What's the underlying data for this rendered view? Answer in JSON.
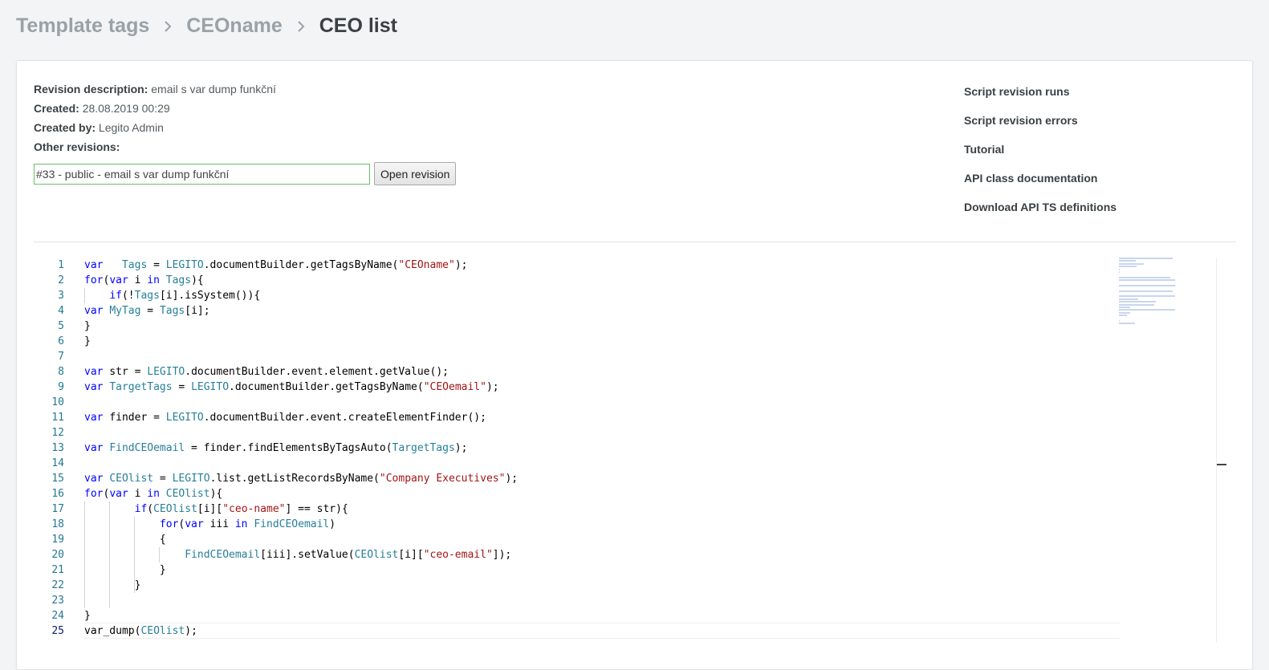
{
  "breadcrumb": {
    "items": [
      "Template tags",
      "CEOname"
    ],
    "current": "CEO list"
  },
  "meta": {
    "description_label": "Revision description:",
    "description_value": "email s var dump funkční",
    "created_label": "Created:",
    "created_value": "28.08.2019 00:29",
    "created_by_label": "Created by:",
    "created_by_value": "Legito Admin",
    "other_revisions_label": "Other revisions:"
  },
  "revision": {
    "selected": "#33 - public - email s var dump funkční",
    "open_button": "Open revision"
  },
  "links": {
    "runs": "Script revision runs",
    "errors": "Script revision errors",
    "tutorial": "Tutorial",
    "api_docs": "API class documentation",
    "ts_defs": "Download API TS definitions"
  },
  "editor": {
    "current_line": 25,
    "lines": [
      [
        [
          "k",
          "var"
        ],
        [
          "",
          "   "
        ],
        [
          "t",
          "Tags"
        ],
        [
          "",
          " = "
        ],
        [
          "t",
          "LEGITO"
        ],
        [
          "",
          ".documentBuilder.getTagsByName("
        ],
        [
          "s",
          "\"CEOname\""
        ],
        [
          "",
          ");"
        ]
      ],
      [
        [
          "k",
          "for"
        ],
        [
          "",
          "("
        ],
        [
          "k",
          "var"
        ],
        [
          "",
          " i "
        ],
        [
          "k",
          "in"
        ],
        [
          "",
          " "
        ],
        [
          "t",
          "Tags"
        ],
        [
          "",
          "){"
        ]
      ],
      [
        [
          "",
          "    "
        ],
        [
          "k",
          "if"
        ],
        [
          "",
          "(!"
        ],
        [
          "t",
          "Tags"
        ],
        [
          "",
          "[i].isSystem()){"
        ]
      ],
      [
        [
          "k",
          "var"
        ],
        [
          "",
          " "
        ],
        [
          "t",
          "MyTag"
        ],
        [
          "",
          " = "
        ],
        [
          "t",
          "Tags"
        ],
        [
          "",
          "[i];"
        ]
      ],
      [
        [
          "",
          "}"
        ]
      ],
      [
        [
          "",
          "}"
        ]
      ],
      [],
      [
        [
          "k",
          "var"
        ],
        [
          "",
          " str = "
        ],
        [
          "t",
          "LEGITO"
        ],
        [
          "",
          ".documentBuilder.event.element.getValue();"
        ]
      ],
      [
        [
          "k",
          "var"
        ],
        [
          "",
          " "
        ],
        [
          "t",
          "TargetTags"
        ],
        [
          "",
          " = "
        ],
        [
          "t",
          "LEGITO"
        ],
        [
          "",
          ".documentBuilder.getTagsByName("
        ],
        [
          "s",
          "\"CEOemail\""
        ],
        [
          "",
          ");"
        ]
      ],
      [],
      [
        [
          "k",
          "var"
        ],
        [
          "",
          " finder = "
        ],
        [
          "t",
          "LEGITO"
        ],
        [
          "",
          ".documentBuilder.event.createElementFinder();"
        ]
      ],
      [],
      [
        [
          "k",
          "var"
        ],
        [
          "",
          " "
        ],
        [
          "t",
          "FindCEOemail"
        ],
        [
          "",
          " = finder.findElementsByTagsAuto("
        ],
        [
          "t",
          "TargetTags"
        ],
        [
          "",
          ");"
        ]
      ],
      [],
      [
        [
          "k",
          "var"
        ],
        [
          "",
          " "
        ],
        [
          "t",
          "CEOlist"
        ],
        [
          "",
          " = "
        ],
        [
          "t",
          "LEGITO"
        ],
        [
          "",
          ".list.getListRecordsByName("
        ],
        [
          "s",
          "\"Company Executives\""
        ],
        [
          "",
          ");"
        ]
      ],
      [
        [
          "k",
          "for"
        ],
        [
          "",
          "("
        ],
        [
          "k",
          "var"
        ],
        [
          "",
          " i "
        ],
        [
          "k",
          "in"
        ],
        [
          "",
          " "
        ],
        [
          "t",
          "CEOlist"
        ],
        [
          "",
          "){"
        ]
      ],
      [
        [
          "",
          "        "
        ],
        [
          "k",
          "if"
        ],
        [
          "",
          "("
        ],
        [
          "t",
          "CEOlist"
        ],
        [
          "",
          "[i]["
        ],
        [
          "s",
          "\"ceo-name\""
        ],
        [
          "",
          "] == str){"
        ]
      ],
      [
        [
          "",
          "            "
        ],
        [
          "k",
          "for"
        ],
        [
          "",
          "("
        ],
        [
          "k",
          "var"
        ],
        [
          "",
          " iii "
        ],
        [
          "k",
          "in"
        ],
        [
          "",
          " "
        ],
        [
          "t",
          "FindCEOemail"
        ],
        [
          "",
          ")"
        ]
      ],
      [
        [
          "",
          "            {"
        ]
      ],
      [
        [
          "",
          "                "
        ],
        [
          "t",
          "FindCEOemail"
        ],
        [
          "",
          "[iii].setValue("
        ],
        [
          "t",
          "CEOlist"
        ],
        [
          "",
          "[i]["
        ],
        [
          "s",
          "\"ceo-email\""
        ],
        [
          "",
          "]);"
        ]
      ],
      [
        [
          "",
          "            }"
        ]
      ],
      [
        [
          "",
          "        }"
        ]
      ],
      [],
      [
        [
          "",
          "}"
        ]
      ],
      [
        [
          "",
          "var_dump("
        ],
        [
          "t",
          "CEOlist"
        ],
        [
          "",
          ");"
        ]
      ]
    ]
  }
}
